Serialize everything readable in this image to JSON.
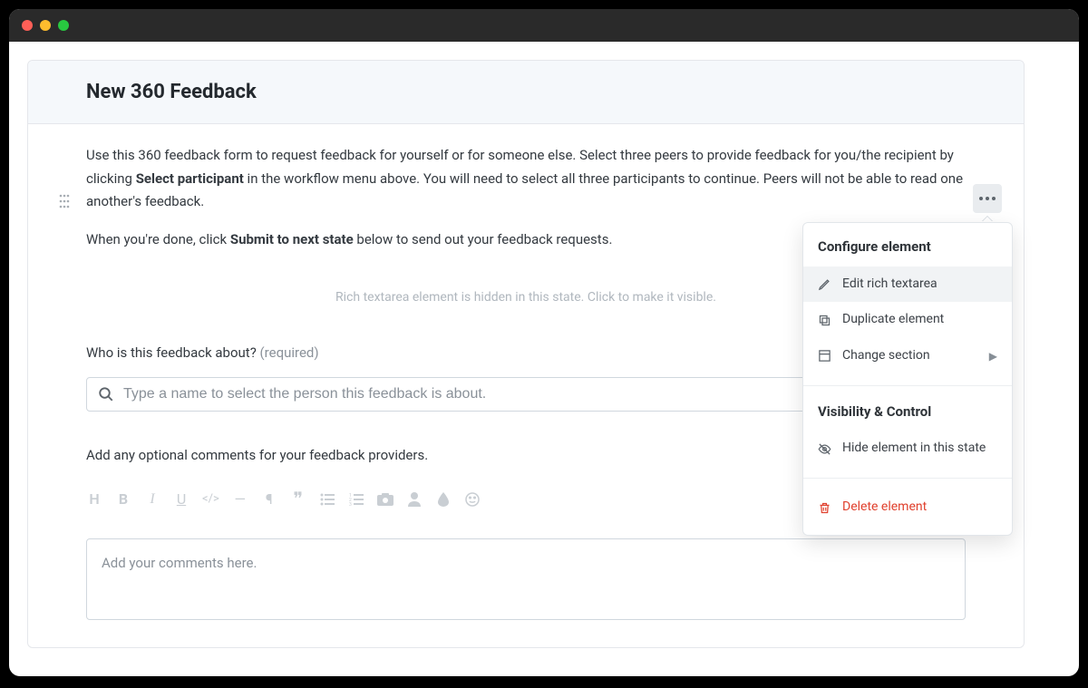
{
  "header": {
    "title": "New 360 Feedback"
  },
  "intro": {
    "para1_pre": "Use this 360 feedback form to request feedback for yourself or for someone else. Select three peers to provide feedback for you/the recipient by clicking ",
    "para1_bold": "Select participant",
    "para1_post": " in the workflow menu above. You will need to select all three participants to continue. Peers will not be able to read one another's feedback.",
    "para2_pre": "When you're done, click ",
    "para2_bold": "Submit to next state",
    "para2_post": " below to send out your feedback requests."
  },
  "hidden_hint": "Rich textarea element is hidden in this state. Click to make it visible.",
  "question1": {
    "label": "Who is this feedback about?",
    "required_label": "(required)",
    "placeholder": "Type a name to select the person this feedback is about."
  },
  "question2": {
    "label": "Add any optional comments for your feedback providers.",
    "placeholder": "Add your comments here."
  },
  "toolbar": {
    "items": [
      "H",
      "B",
      "I",
      "U",
      "</>",
      "—",
      "¶",
      "❝",
      "list-ul",
      "list-ol",
      "camera",
      "person",
      "droplet",
      "smile"
    ]
  },
  "popover": {
    "section1_title": "Configure element",
    "item_edit": "Edit rich textarea",
    "item_duplicate": "Duplicate element",
    "item_change_section": "Change section",
    "section2_title": "Visibility & Control",
    "item_hide": "Hide element in this state",
    "item_delete": "Delete element"
  }
}
